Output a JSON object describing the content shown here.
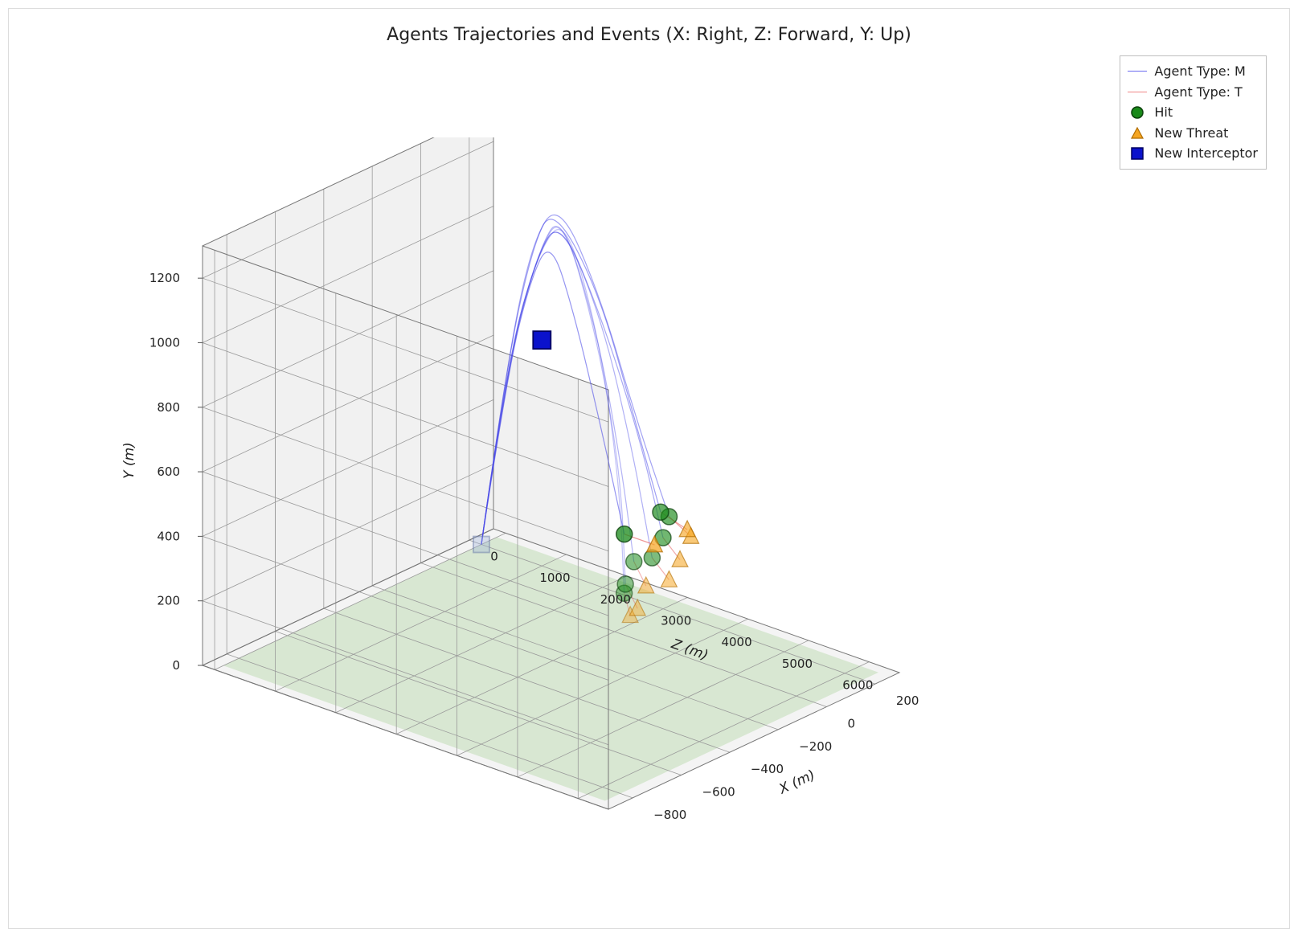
{
  "chart_data": {
    "type": "scatter3d",
    "title": "Agents Trajectories and Events (X: Right, Z: Forward, Y: Up)",
    "axes": {
      "x": {
        "label": "X (m)",
        "ticks": [
          -800,
          -600,
          -400,
          -200,
          0,
          200
        ],
        "range": [
          -900,
          300
        ]
      },
      "y": {
        "label": "Y (m)",
        "ticks": [
          0,
          200,
          400,
          600,
          800,
          1000,
          1200
        ],
        "range": [
          0,
          1300
        ]
      },
      "z": {
        "label": "Z (m)",
        "ticks": [
          0,
          1000,
          2000,
          3000,
          4000,
          5000,
          6000
        ],
        "range": [
          -200,
          6500
        ]
      }
    },
    "legend": {
      "items": [
        {
          "id": "agent-m",
          "label": "Agent Type: M",
          "kind": "line",
          "color": "#4a4ae8"
        },
        {
          "id": "agent-t",
          "label": "Agent Type: T",
          "kind": "line",
          "color": "#e24c4c"
        },
        {
          "id": "hit",
          "label": "Hit",
          "kind": "marker",
          "shape": "circle",
          "fill": "#1a8a1a",
          "stroke": "#0c400c"
        },
        {
          "id": "new-threat",
          "label": "New Threat",
          "kind": "marker",
          "shape": "triangle",
          "fill": "#f5a623",
          "stroke": "#b06c00"
        },
        {
          "id": "new-interceptor",
          "label": "New Interceptor",
          "kind": "marker",
          "shape": "square",
          "fill": "#0b12cc",
          "stroke": "#000060"
        }
      ]
    },
    "series": [
      {
        "name": "Agent Type: M",
        "kind": "trajectory",
        "color": "#4a4ae8",
        "note": "Approximate arcing interceptor trajectories from launch near (x≈200, z≈0, y≈0) rising to ~y=1200 near z≈1500 then descending toward hit points.",
        "trajectories_xyz": [
          [
            [
              200,
              0,
              0
            ],
            [
              180,
              500,
              600
            ],
            [
              160,
              1000,
              1000
            ],
            [
              120,
              1500,
              1180
            ],
            [
              60,
              2500,
              1000
            ],
            [
              -40,
              3500,
              700
            ],
            [
              -160,
              4400,
              520
            ]
          ],
          [
            [
              200,
              0,
              0
            ],
            [
              180,
              500,
              600
            ],
            [
              160,
              1000,
              1020
            ],
            [
              120,
              1600,
              1200
            ],
            [
              40,
              2600,
              1000
            ],
            [
              -80,
              3700,
              720
            ],
            [
              -200,
              4700,
              540
            ]
          ],
          [
            [
              200,
              0,
              0
            ],
            [
              180,
              500,
              580
            ],
            [
              150,
              1100,
              980
            ],
            [
              100,
              1700,
              1160
            ],
            [
              20,
              2700,
              950
            ],
            [
              -120,
              3900,
              700
            ],
            [
              -300,
              5000,
              530
            ]
          ],
          [
            [
              200,
              0,
              0
            ],
            [
              180,
              500,
              580
            ],
            [
              150,
              1100,
              980
            ],
            [
              100,
              1700,
              1160
            ],
            [
              0,
              2800,
              950
            ],
            [
              -200,
              4100,
              700
            ],
            [
              -420,
              5300,
              530
            ]
          ],
          [
            [
              200,
              0,
              0
            ],
            [
              170,
              550,
              620
            ],
            [
              140,
              1200,
              1020
            ],
            [
              80,
              1800,
              1190
            ],
            [
              -50,
              2900,
              950
            ],
            [
              -300,
              4300,
              720
            ],
            [
              -520,
              5400,
              560
            ]
          ],
          [
            [
              200,
              0,
              0
            ],
            [
              170,
              550,
              620
            ],
            [
              140,
              1200,
              1020
            ],
            [
              60,
              1900,
              1200
            ],
            [
              -120,
              3200,
              960
            ],
            [
              -400,
              4700,
              740
            ],
            [
              -680,
              5900,
              580
            ]
          ],
          [
            [
              200,
              0,
              0
            ],
            [
              170,
              550,
              620
            ],
            [
              140,
              1200,
              1020
            ],
            [
              50,
              2000,
              1200
            ],
            [
              -160,
              3400,
              980
            ],
            [
              -480,
              5000,
              760
            ],
            [
              -760,
              6200,
              600
            ]
          ],
          [
            [
              200,
              0,
              0
            ],
            [
              180,
              500,
              560
            ],
            [
              150,
              1000,
              900
            ],
            [
              110,
              1500,
              1080
            ],
            [
              60,
              2100,
              900
            ],
            [
              0,
              2800,
              600
            ],
            [
              -60,
              3400,
              350
            ]
          ]
        ]
      },
      {
        "name": "Agent Type: T",
        "kind": "trajectory",
        "color": "#e24c4c",
        "note": "Approximate short threat trajectories near each threat marker heading toward hit points.",
        "trajectories_xyz": [
          [
            [
              -60,
              3900,
              350
            ],
            [
              -60,
              3400,
              350
            ]
          ],
          [
            [
              -200,
              5000,
              520
            ],
            [
              -160,
              4400,
              520
            ]
          ],
          [
            [
              -260,
              5300,
              540
            ],
            [
              -200,
              4700,
              540
            ]
          ],
          [
            [
              -380,
              5600,
              530
            ],
            [
              -300,
              5000,
              530
            ]
          ],
          [
            [
              -500,
              5900,
              530
            ],
            [
              -420,
              5300,
              530
            ]
          ],
          [
            [
              -620,
              6000,
              560
            ],
            [
              -520,
              5400,
              560
            ]
          ],
          [
            [
              -780,
              6500,
              580
            ],
            [
              -680,
              5900,
              580
            ]
          ],
          [
            [
              -860,
              6700,
              600
            ],
            [
              -760,
              6200,
              600
            ]
          ]
        ]
      }
    ],
    "events": {
      "hit_xyz": [
        [
          -60,
          3400,
          350
        ],
        [
          -160,
          4400,
          520
        ],
        [
          -200,
          4700,
          540
        ],
        [
          -300,
          5000,
          530
        ],
        [
          -420,
          5300,
          530
        ],
        [
          -520,
          5400,
          560
        ],
        [
          -680,
          5900,
          580
        ],
        [
          -760,
          6200,
          600
        ]
      ],
      "new_threat_xyz": [
        [
          -60,
          3900,
          350
        ],
        [
          -200,
          5000,
          520
        ],
        [
          -260,
          5300,
          540
        ],
        [
          -380,
          5600,
          530
        ],
        [
          -500,
          5900,
          530
        ],
        [
          -620,
          6000,
          560
        ],
        [
          -780,
          6500,
          580
        ],
        [
          -860,
          6700,
          600
        ]
      ],
      "new_interceptor_xyz": [
        [
          200,
          1000,
          700
        ],
        [
          200,
          0,
          0
        ]
      ]
    },
    "ground_plane": {
      "y": 0,
      "color": "#b6d7a8",
      "opacity": 0.45
    }
  }
}
